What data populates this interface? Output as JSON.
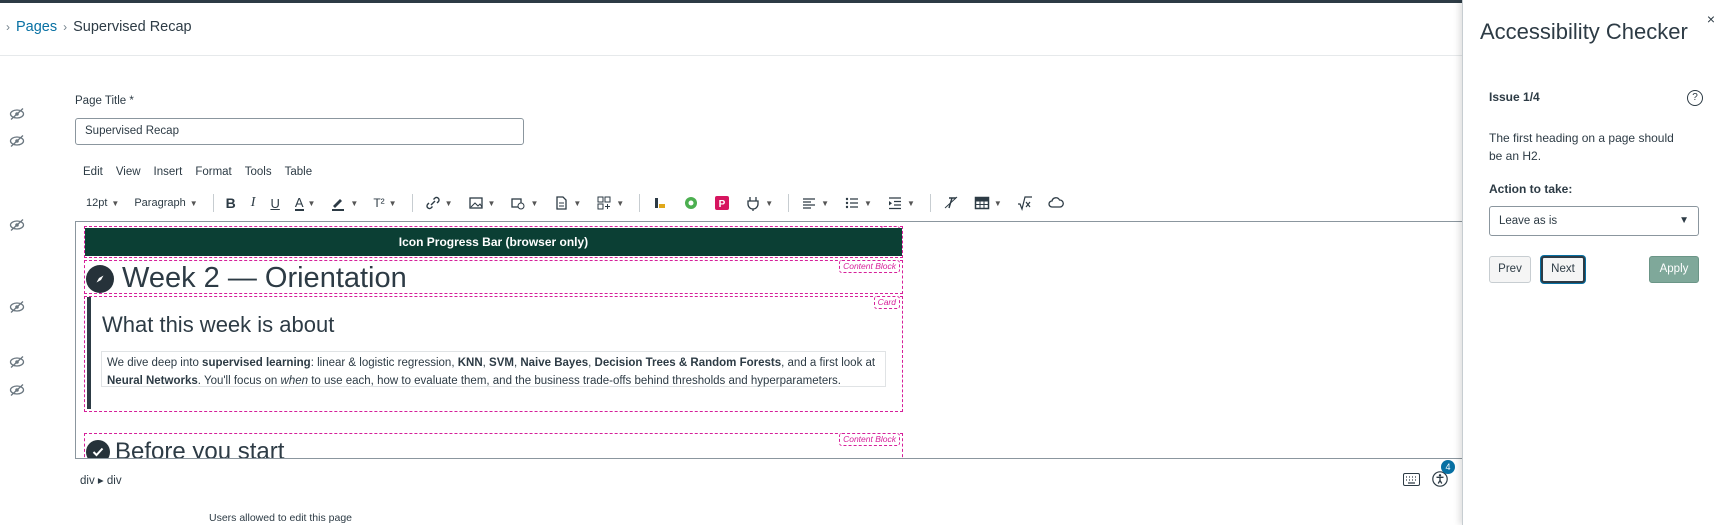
{
  "breadcrumb": {
    "prefix": "›",
    "pages_label": "Pages",
    "separator": "›",
    "current": "Supervised Recap"
  },
  "form": {
    "title_label": "Page Title *",
    "title_value": "Supervised Recap"
  },
  "menubar": [
    "Edit",
    "View",
    "Insert",
    "Format",
    "Tools",
    "Table"
  ],
  "toolbar": {
    "font_size": "12pt",
    "block_format": "Paragraph",
    "bold": "B",
    "italic": "I",
    "underline": "U",
    "text_color": "A",
    "superscript": "T²"
  },
  "content": {
    "banner_tag": "div",
    "banner_text": "Icon Progress Bar (browser only)",
    "block_tag": "Content Block",
    "heading1": "Week 2 — Orientation",
    "card_tag": "Card",
    "heading2": "What this week is about",
    "para_parts": {
      "p1": "We dive deep into ",
      "b1": "supervised learning",
      "p2": ": linear & logistic regression, ",
      "b2": "KNN",
      "p3": ", ",
      "b3": "SVM",
      "p4": ", ",
      "b4": "Naive Bayes",
      "p5": ", ",
      "b5": "Decision Trees & Random Forests",
      "p6": ", and a first look at ",
      "b6": "Neural Networks",
      "p7": ". You'll focus on ",
      "i1": "when",
      "p8": " to use each, how to evaluate them, and the business trade-offs behind thresholds and hyperparameters."
    },
    "heading3": "Before you start",
    "block_tag2": "Content Block"
  },
  "statusbar": {
    "path": "div ▸ div",
    "issue_count": "4"
  },
  "permissions_label": "Users allowed to edit this page",
  "checker": {
    "title": "Accessibility Checker",
    "close": "×",
    "issue": "Issue 1/4",
    "help": "?",
    "message": "The first heading on a page should be an H2.",
    "action_label": "Action to take:",
    "action_value": "Leave as is",
    "prev": "Prev",
    "next": "Next",
    "apply": "Apply"
  },
  "colors": {
    "brand": "#0b3f34",
    "link": "#0770a3",
    "debug_outline": "#d61f9a",
    "apply_disabled": "#7fa89a"
  },
  "icons": [
    "eye-off-icon",
    "link-icon",
    "image-icon",
    "media-icon",
    "document-icon",
    "apps-icon",
    "align-icon",
    "bullet-list-icon",
    "indent-icon",
    "clear-format-icon",
    "table-icon",
    "math-icon",
    "cloud-icon",
    "keyboard-icon",
    "accessibility-icon",
    "compass-icon",
    "check-circle-icon"
  ]
}
